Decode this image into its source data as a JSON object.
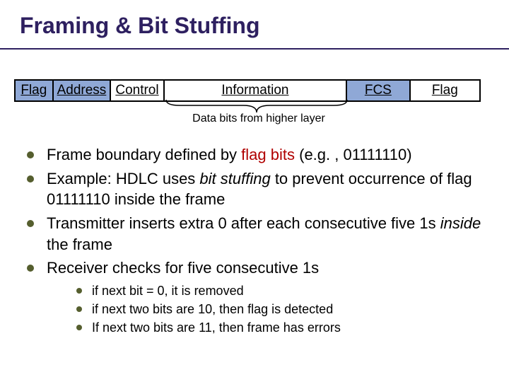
{
  "title": "Framing & Bit Stuffing",
  "frame": {
    "flag1": "Flag",
    "address": "Address",
    "control": "Control",
    "info": "Information",
    "fcs": "FCS",
    "flag2": "Flag"
  },
  "brace_label": "Data bits from higher layer",
  "bullets": {
    "b1_pre": "Frame boundary defined by ",
    "b1_hl": "flag bits",
    "b1_post": " (e.g. , 01111110)",
    "b2_pre": "Example: HDLC uses ",
    "b2_it": "bit stuffing",
    "b2_post": " to prevent occurrence of flag 01111110 inside the frame",
    "b3_pre": "Transmitter inserts extra 0 after each consecutive five 1s ",
    "b3_it": "inside",
    "b3_post": " the frame",
    "b4": "Receiver checks for five consecutive 1s"
  },
  "sub": {
    "s1": "if next bit = 0, it is removed",
    "s2": "if next two bits are 10, then flag is detected",
    "s3": "If next two bits are 11, then frame has errors"
  }
}
